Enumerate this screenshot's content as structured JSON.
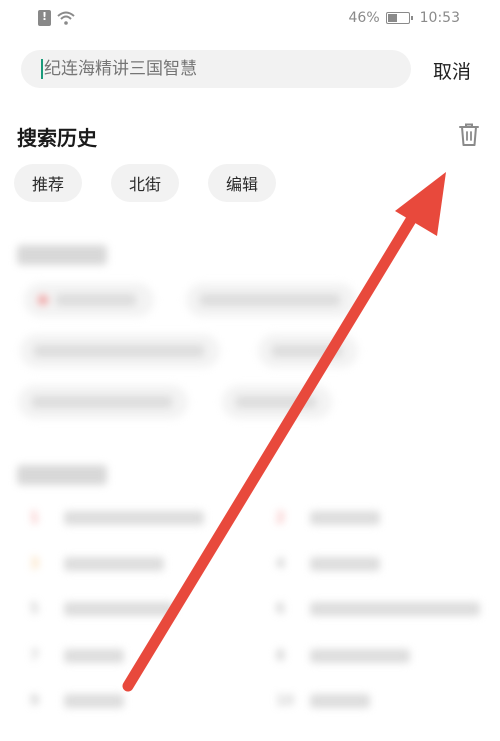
{
  "status_bar": {
    "battery_percent": "46%",
    "time": "10:53"
  },
  "search": {
    "placeholder": "纪连海精讲三国智慧",
    "cancel_label": "取消"
  },
  "history": {
    "title": "搜索历史",
    "chips": [
      "推荐",
      "北街",
      "编辑"
    ]
  },
  "colors": {
    "arrow": "#e8493c",
    "caret": "#1a9a7a"
  },
  "icons": {
    "trash": "trash-icon",
    "wifi": "wifi-icon",
    "battery": "battery-icon",
    "sim": "sim-icon"
  }
}
